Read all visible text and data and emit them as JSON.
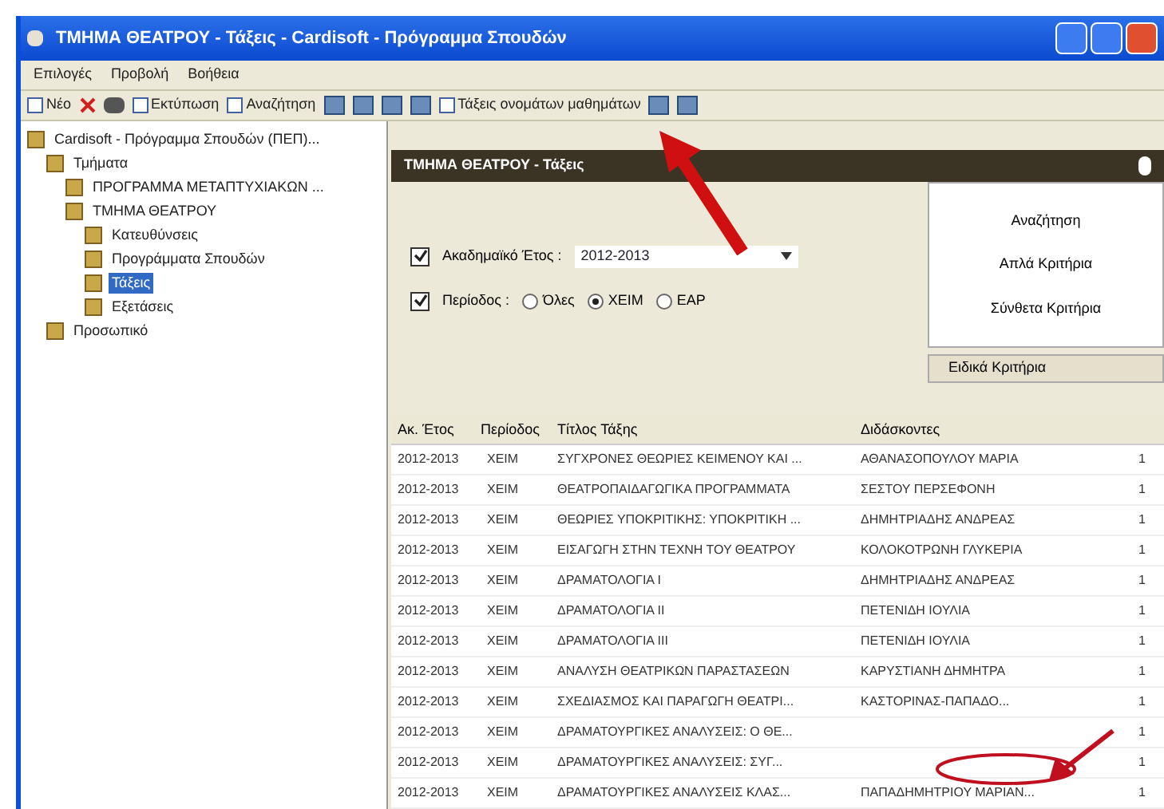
{
  "window": {
    "title": "ΤΜΗΜΑ ΘΕΑΤΡΟΥ - Τάξεις - Cardisoft - Πρόγραμμα Σπουδών"
  },
  "menu": [
    "Επιλογές",
    "Προβολή",
    "Βοήθεια"
  ],
  "toolbar": [
    {
      "kind": "icon-label",
      "label": "Νέο"
    },
    {
      "kind": "delete"
    },
    {
      "kind": "print"
    },
    {
      "kind": "icon-label",
      "label": "Εκτύπωση"
    },
    {
      "kind": "icon-label",
      "label": "Αναζήτηση"
    },
    {
      "kind": "icon"
    },
    {
      "kind": "icon"
    },
    {
      "kind": "icon"
    },
    {
      "kind": "icon"
    },
    {
      "kind": "icon-label",
      "label": "Τάξεις ονομάτων μαθημάτων"
    },
    {
      "kind": "icon"
    },
    {
      "kind": "icon"
    }
  ],
  "tree": [
    {
      "label": "Cardisoft - Πρόγραμμα Σπουδών (ΠΕΠ)...",
      "selected": false,
      "children": [
        {
          "label": "Τμήματα",
          "selected": false,
          "children": [
            {
              "label": "ΠΡΟΓΡΑΜΜΑ ΜΕΤΑΠΤΥΧΙΑΚΩΝ ...",
              "selected": false
            },
            {
              "label": "ΤΜΗΜΑ ΘΕΑΤΡΟΥ",
              "selected": false,
              "children": [
                {
                  "label": "Κατευθύνσεις",
                  "selected": false
                },
                {
                  "label": "Προγράμματα Σπουδών",
                  "selected": false
                },
                {
                  "label": "Τάξεις",
                  "selected": true
                },
                {
                  "label": "Εξετάσεις",
                  "selected": false
                }
              ]
            }
          ]
        },
        {
          "label": "Προσωπικό",
          "selected": false
        }
      ]
    }
  ],
  "panel": {
    "title": "ΤΜΗΜΑ ΘΕΑΤΡΟΥ - Τάξεις",
    "year": {
      "label": "Ακαδημαϊκό Έτος :",
      "checked": true,
      "value": "2012-2013"
    },
    "period": {
      "label": "Περίοδος :",
      "checked": true,
      "options": [
        {
          "label": "Όλες",
          "selected": false
        },
        {
          "label": "ΧΕΙΜ",
          "selected": true
        },
        {
          "label": "ΕΑΡ",
          "selected": false
        }
      ]
    },
    "search": {
      "title": "Αναζήτηση",
      "items": [
        "Απλά Κριτήρια",
        "Σύνθετα Κριτήρια"
      ],
      "special": "Ειδικά Κριτήρια"
    }
  },
  "table": {
    "columns": [
      "Ακ. Έτος",
      "Περίοδος",
      "Τίτλος Τάξης",
      "Διδάσκοντες"
    ],
    "rows": [
      [
        "2012-2013",
        "ΧΕΙΜ",
        "ΣΥΓΧΡΟΝΕΣ ΘΕΩΡΙΕΣ ΚΕΙΜΕΝΟΥ ΚΑΙ ...",
        "ΑΘΑΝΑΣΟΠΟΥΛΟΥ ΜΑΡΙΑ",
        "1"
      ],
      [
        "2012-2013",
        "ΧΕΙΜ",
        "ΘΕΑΤΡΟΠΑΙΔΑΓΩΓΙΚΑ ΠΡΟΓΡΑΜΜΑΤΑ",
        "ΣΕΣΤΟΥ ΠΕΡΣΕΦΟΝΗ",
        "1"
      ],
      [
        "2012-2013",
        "ΧΕΙΜ",
        "ΘΕΩΡΙΕΣ ΥΠΟΚΡΙΤΙΚΗΣ: ΥΠΟΚΡΙΤΙΚΗ ...",
        "ΔΗΜΗΤΡΙΑΔΗΣ ΑΝΔΡΕΑΣ",
        "1"
      ],
      [
        "2012-2013",
        "ΧΕΙΜ",
        "ΕΙΣΑΓΩΓΗ ΣΤΗΝ ΤΕΧΝΗ ΤΟΥ ΘΕΑΤΡΟΥ",
        "ΚΟΛΟΚΟΤΡΩΝΗ ΓΛΥΚΕΡΙΑ",
        "1"
      ],
      [
        "2012-2013",
        "ΧΕΙΜ",
        "ΔΡΑΜΑΤΟΛΟΓΙΑ I",
        "ΔΗΜΗΤΡΙΑΔΗΣ ΑΝΔΡΕΑΣ",
        "1"
      ],
      [
        "2012-2013",
        "ΧΕΙΜ",
        "ΔΡΑΜΑΤΟΛΟΓΙΑ II",
        "ΠΕΤΕΝΙΔΗ ΙΟΥΛΙΑ",
        "1"
      ],
      [
        "2012-2013",
        "ΧΕΙΜ",
        "ΔΡΑΜΑΤΟΛΟΓΙΑ III",
        "ΠΕΤΕΝΙΔΗ ΙΟΥΛΙΑ",
        "1"
      ],
      [
        "2012-2013",
        "ΧΕΙΜ",
        "ΑΝΑΛΥΣΗ ΘΕΑΤΡΙΚΩΝ ΠΑΡΑΣΤΑΣΕΩΝ",
        "ΚΑΡΥΣΤΙΑΝΗ ΔΗΜΗΤΡΑ",
        "1"
      ],
      [
        "2012-2013",
        "ΧΕΙΜ",
        "ΣΧΕΔΙΑΣΜΟΣ ΚΑΙ ΠΑΡΑΓΩΓΗ ΘΕΑΤΡΙ...",
        "ΚΑΣΤΟΡΙΝΑΣ-ΠΑΠΑΔΟ...",
        "1"
      ],
      [
        "2012-2013",
        "ΧΕΙΜ",
        "ΔΡΑΜΑΤΟΥΡΓΙΚΕΣ ΑΝΑΛΥΣΕΙΣ: Ο ΘΕ...",
        "",
        "1"
      ],
      [
        "2012-2013",
        "ΧΕΙΜ",
        "ΔΡΑΜΑΤΟΥΡΓΙΚΕΣ ΑΝΑΛΥΣΕΙΣ: ΣΥΓ...",
        "",
        "1"
      ],
      [
        "2012-2013",
        "ΧΕΙΜ",
        "ΔΡΑΜΑΤΟΥΡΓΙΚΕΣ ΑΝΑΛΥΣΕΙΣ ΚΛΑΣ...",
        "ΠΑΠΑΔΗΜΗΤΡΙΟΥ ΜΑΡΙΑΝ...",
        "1"
      ]
    ]
  }
}
